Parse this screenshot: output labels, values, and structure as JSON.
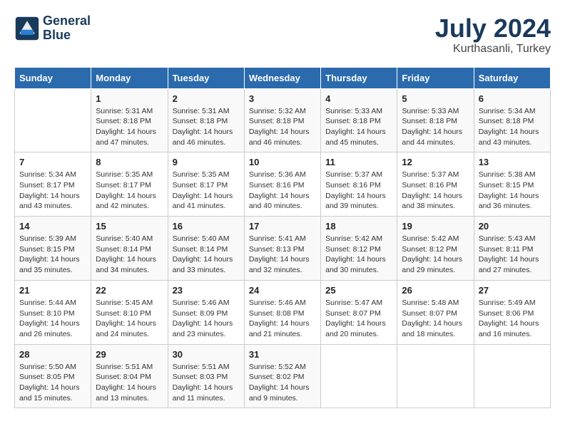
{
  "header": {
    "logo_line1": "General",
    "logo_line2": "Blue",
    "month": "July 2024",
    "location": "Kurthasanli, Turkey"
  },
  "columns": [
    "Sunday",
    "Monday",
    "Tuesday",
    "Wednesday",
    "Thursday",
    "Friday",
    "Saturday"
  ],
  "weeks": [
    [
      {
        "day": "",
        "info": ""
      },
      {
        "day": "1",
        "info": "Sunrise: 5:31 AM\nSunset: 8:18 PM\nDaylight: 14 hours\nand 47 minutes."
      },
      {
        "day": "2",
        "info": "Sunrise: 5:31 AM\nSunset: 8:18 PM\nDaylight: 14 hours\nand 46 minutes."
      },
      {
        "day": "3",
        "info": "Sunrise: 5:32 AM\nSunset: 8:18 PM\nDaylight: 14 hours\nand 46 minutes."
      },
      {
        "day": "4",
        "info": "Sunrise: 5:33 AM\nSunset: 8:18 PM\nDaylight: 14 hours\nand 45 minutes."
      },
      {
        "day": "5",
        "info": "Sunrise: 5:33 AM\nSunset: 8:18 PM\nDaylight: 14 hours\nand 44 minutes."
      },
      {
        "day": "6",
        "info": "Sunrise: 5:34 AM\nSunset: 8:18 PM\nDaylight: 14 hours\nand 43 minutes."
      }
    ],
    [
      {
        "day": "7",
        "info": "Sunrise: 5:34 AM\nSunset: 8:17 PM\nDaylight: 14 hours\nand 43 minutes."
      },
      {
        "day": "8",
        "info": "Sunrise: 5:35 AM\nSunset: 8:17 PM\nDaylight: 14 hours\nand 42 minutes."
      },
      {
        "day": "9",
        "info": "Sunrise: 5:35 AM\nSunset: 8:17 PM\nDaylight: 14 hours\nand 41 minutes."
      },
      {
        "day": "10",
        "info": "Sunrise: 5:36 AM\nSunset: 8:16 PM\nDaylight: 14 hours\nand 40 minutes."
      },
      {
        "day": "11",
        "info": "Sunrise: 5:37 AM\nSunset: 8:16 PM\nDaylight: 14 hours\nand 39 minutes."
      },
      {
        "day": "12",
        "info": "Sunrise: 5:37 AM\nSunset: 8:16 PM\nDaylight: 14 hours\nand 38 minutes."
      },
      {
        "day": "13",
        "info": "Sunrise: 5:38 AM\nSunset: 8:15 PM\nDaylight: 14 hours\nand 36 minutes."
      }
    ],
    [
      {
        "day": "14",
        "info": "Sunrise: 5:39 AM\nSunset: 8:15 PM\nDaylight: 14 hours\nand 35 minutes."
      },
      {
        "day": "15",
        "info": "Sunrise: 5:40 AM\nSunset: 8:14 PM\nDaylight: 14 hours\nand 34 minutes."
      },
      {
        "day": "16",
        "info": "Sunrise: 5:40 AM\nSunset: 8:14 PM\nDaylight: 14 hours\nand 33 minutes."
      },
      {
        "day": "17",
        "info": "Sunrise: 5:41 AM\nSunset: 8:13 PM\nDaylight: 14 hours\nand 32 minutes."
      },
      {
        "day": "18",
        "info": "Sunrise: 5:42 AM\nSunset: 8:12 PM\nDaylight: 14 hours\nand 30 minutes."
      },
      {
        "day": "19",
        "info": "Sunrise: 5:42 AM\nSunset: 8:12 PM\nDaylight: 14 hours\nand 29 minutes."
      },
      {
        "day": "20",
        "info": "Sunrise: 5:43 AM\nSunset: 8:11 PM\nDaylight: 14 hours\nand 27 minutes."
      }
    ],
    [
      {
        "day": "21",
        "info": "Sunrise: 5:44 AM\nSunset: 8:10 PM\nDaylight: 14 hours\nand 26 minutes."
      },
      {
        "day": "22",
        "info": "Sunrise: 5:45 AM\nSunset: 8:10 PM\nDaylight: 14 hours\nand 24 minutes."
      },
      {
        "day": "23",
        "info": "Sunrise: 5:46 AM\nSunset: 8:09 PM\nDaylight: 14 hours\nand 23 minutes."
      },
      {
        "day": "24",
        "info": "Sunrise: 5:46 AM\nSunset: 8:08 PM\nDaylight: 14 hours\nand 21 minutes."
      },
      {
        "day": "25",
        "info": "Sunrise: 5:47 AM\nSunset: 8:07 PM\nDaylight: 14 hours\nand 20 minutes."
      },
      {
        "day": "26",
        "info": "Sunrise: 5:48 AM\nSunset: 8:07 PM\nDaylight: 14 hours\nand 18 minutes."
      },
      {
        "day": "27",
        "info": "Sunrise: 5:49 AM\nSunset: 8:06 PM\nDaylight: 14 hours\nand 16 minutes."
      }
    ],
    [
      {
        "day": "28",
        "info": "Sunrise: 5:50 AM\nSunset: 8:05 PM\nDaylight: 14 hours\nand 15 minutes."
      },
      {
        "day": "29",
        "info": "Sunrise: 5:51 AM\nSunset: 8:04 PM\nDaylight: 14 hours\nand 13 minutes."
      },
      {
        "day": "30",
        "info": "Sunrise: 5:51 AM\nSunset: 8:03 PM\nDaylight: 14 hours\nand 11 minutes."
      },
      {
        "day": "31",
        "info": "Sunrise: 5:52 AM\nSunset: 8:02 PM\nDaylight: 14 hours\nand 9 minutes."
      },
      {
        "day": "",
        "info": ""
      },
      {
        "day": "",
        "info": ""
      },
      {
        "day": "",
        "info": ""
      }
    ]
  ]
}
